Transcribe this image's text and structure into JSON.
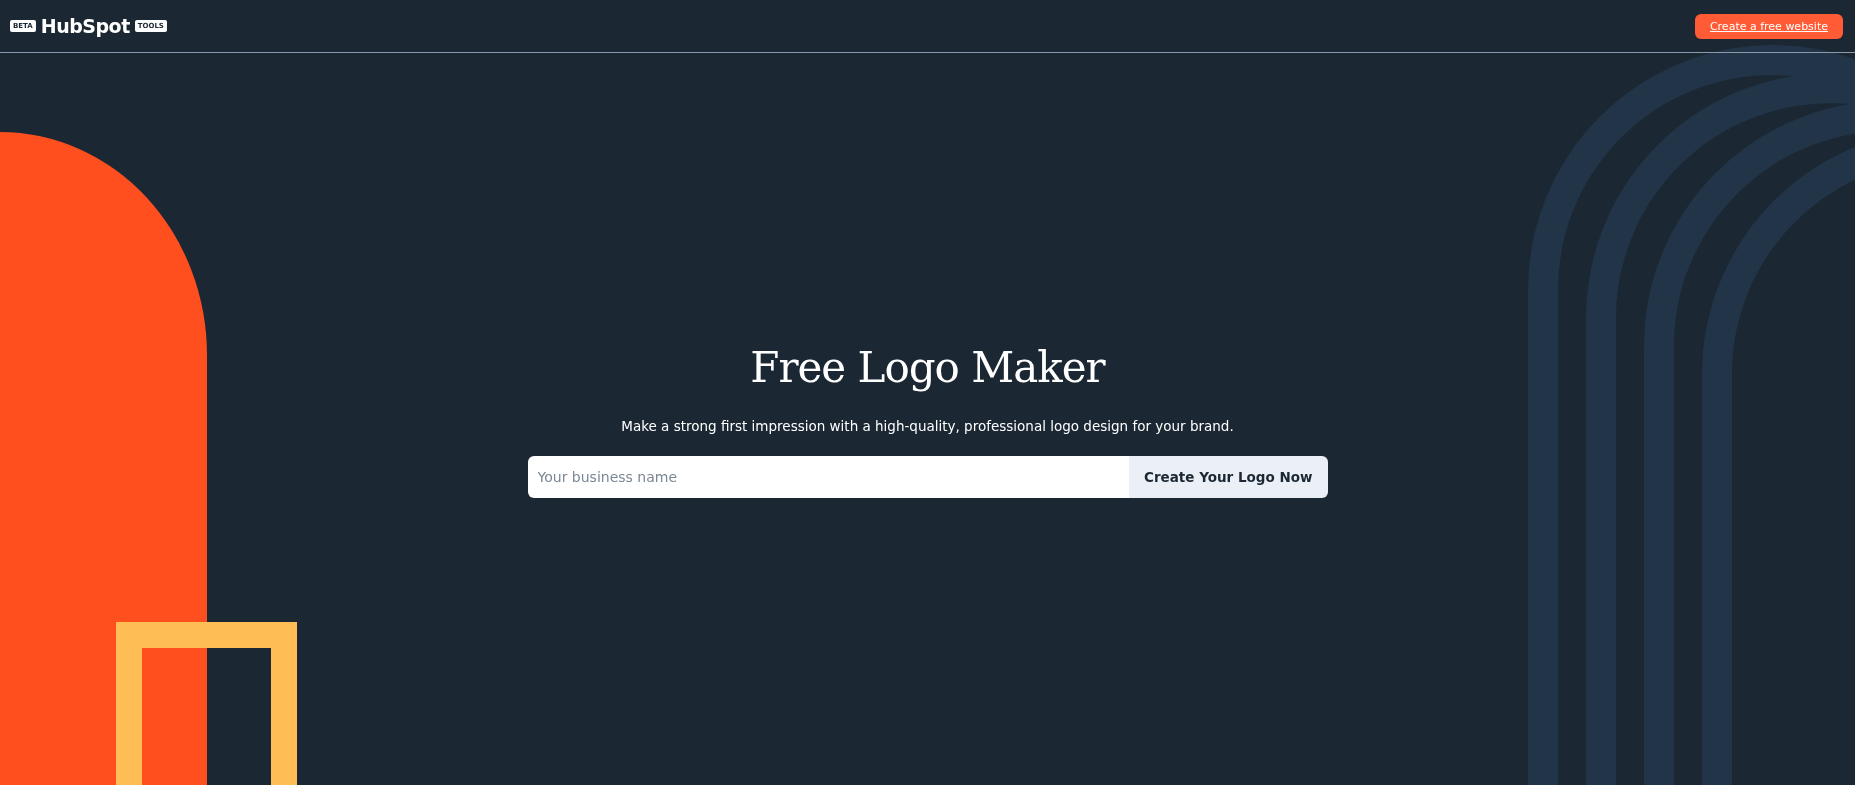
{
  "header": {
    "beta_badge": "BETA",
    "brand": "HubSpot",
    "tools_badge": "TOOLS",
    "cta": "Create a free website"
  },
  "hero": {
    "title": "Free Logo Maker",
    "subtitle": "Make a strong first impression with a high-quality, professional logo design for your brand.",
    "input": {
      "placeholder": "Your business name"
    },
    "button": "Create Your Logo Now"
  }
}
